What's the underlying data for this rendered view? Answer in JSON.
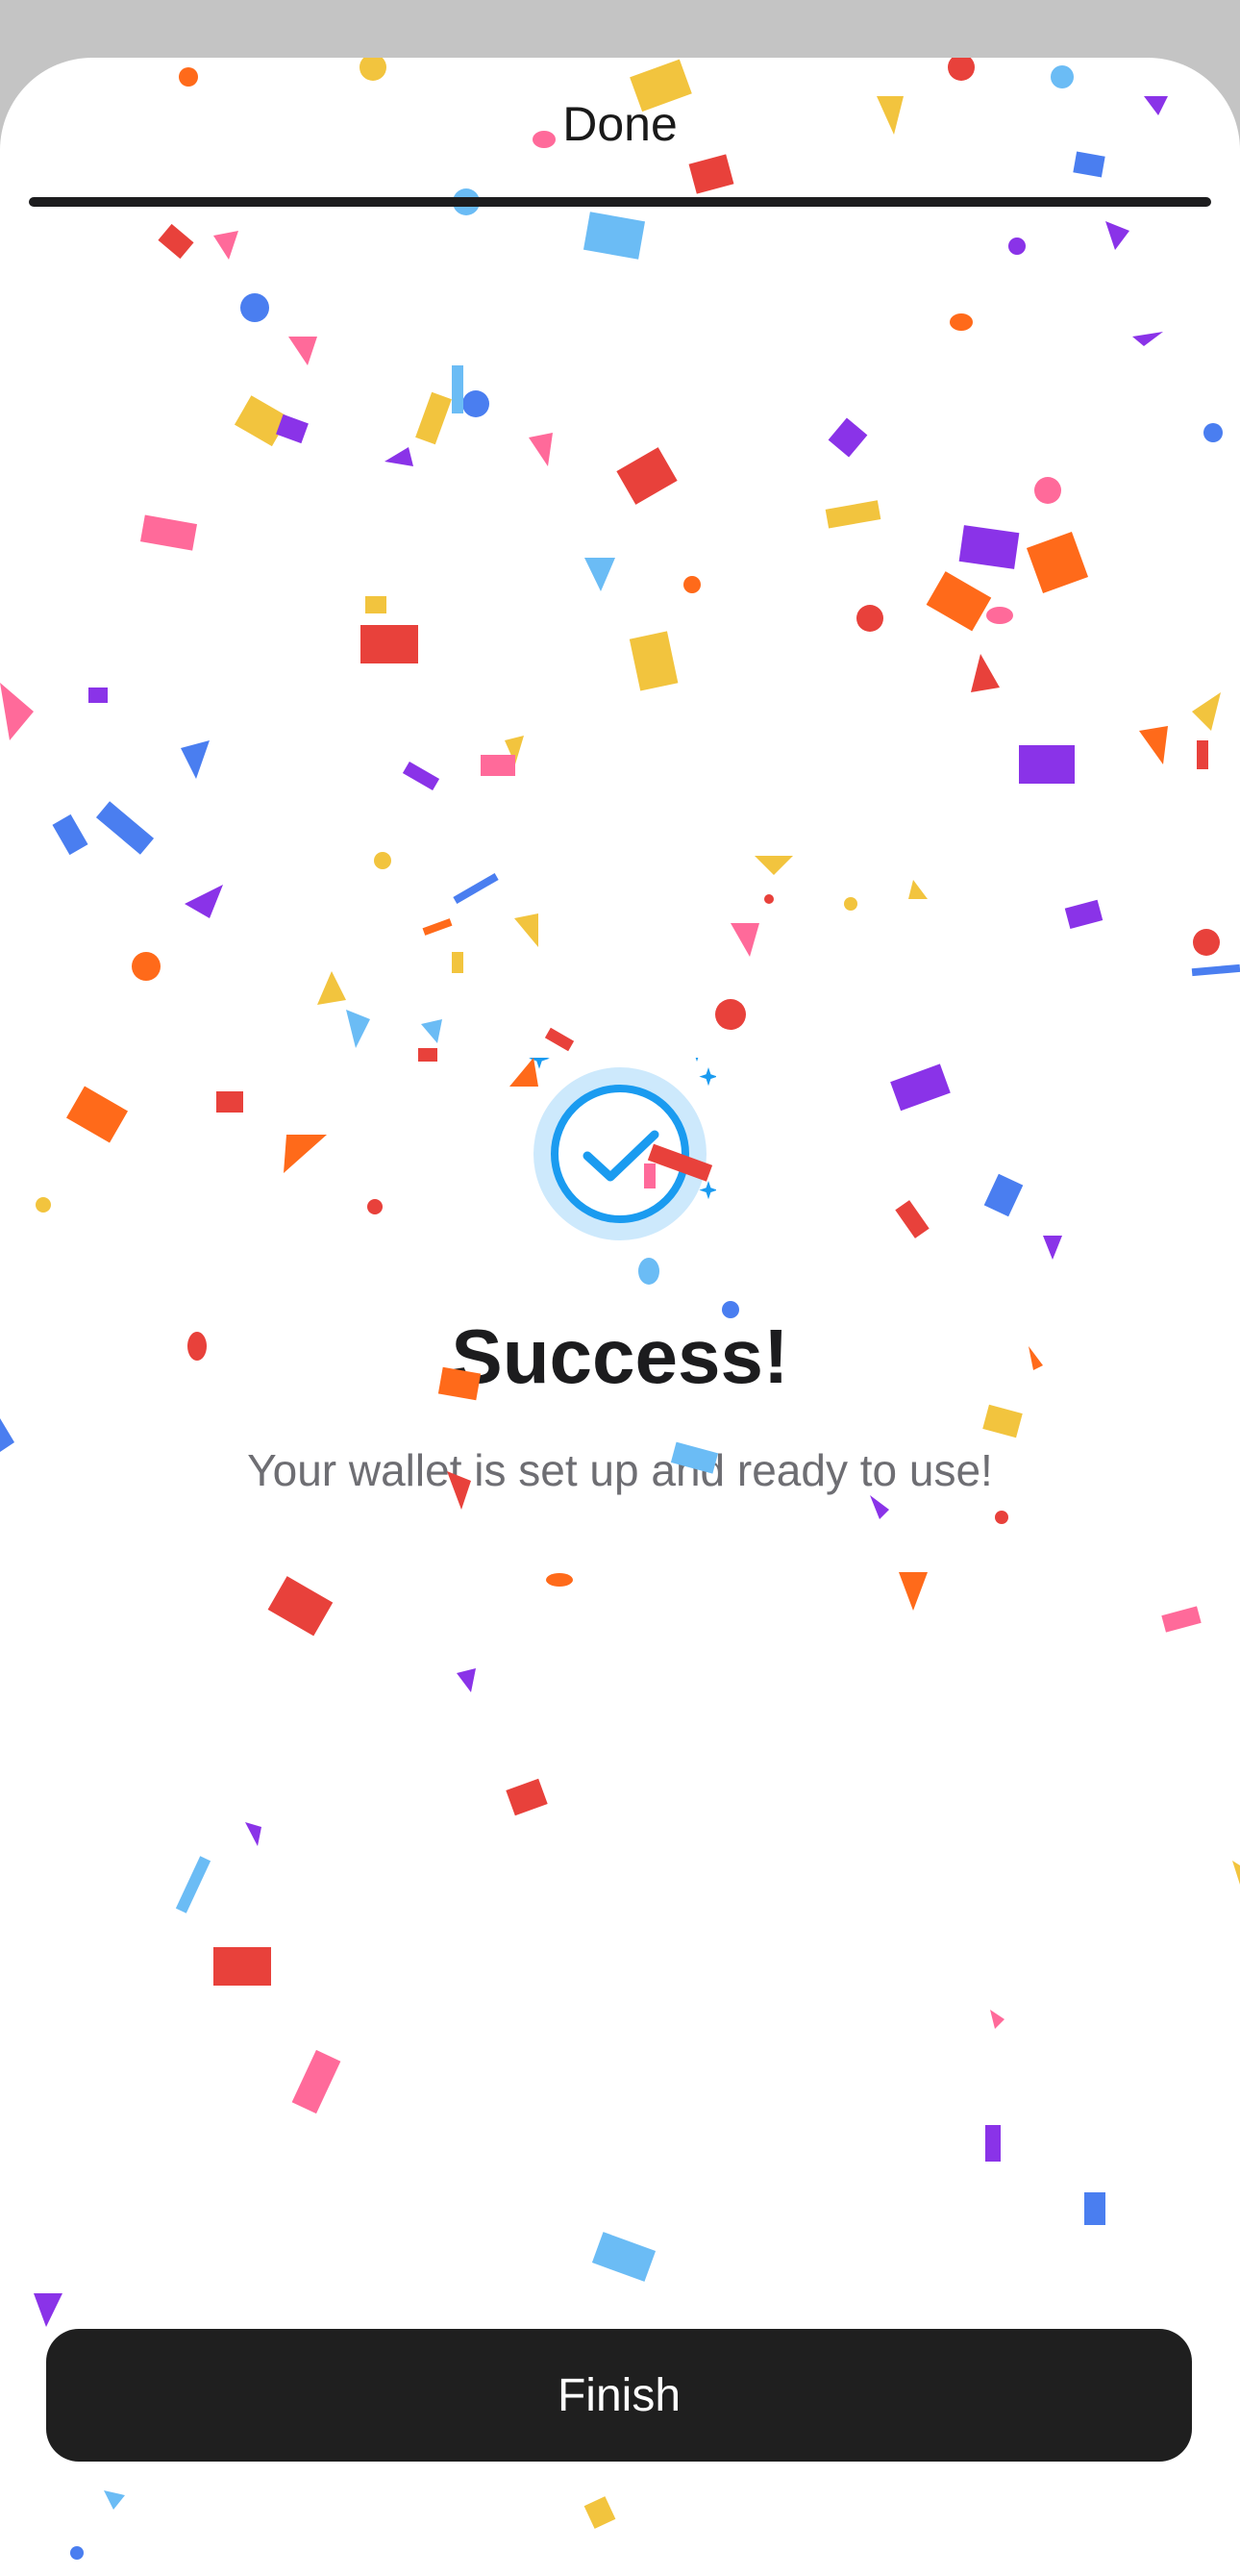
{
  "header": {
    "title": "Done",
    "progress": 1.0
  },
  "main": {
    "title": "Success!",
    "subtitle": "Your wallet is set up and ready to use!",
    "icon": "check-circle-icon"
  },
  "footer": {
    "finish_label": "Finish"
  },
  "colors": {
    "accent": "#1a9bf0",
    "accent_light": "#cde9fc",
    "button_bg": "#1f1f1f",
    "overlay": "#c4c4c4"
  }
}
